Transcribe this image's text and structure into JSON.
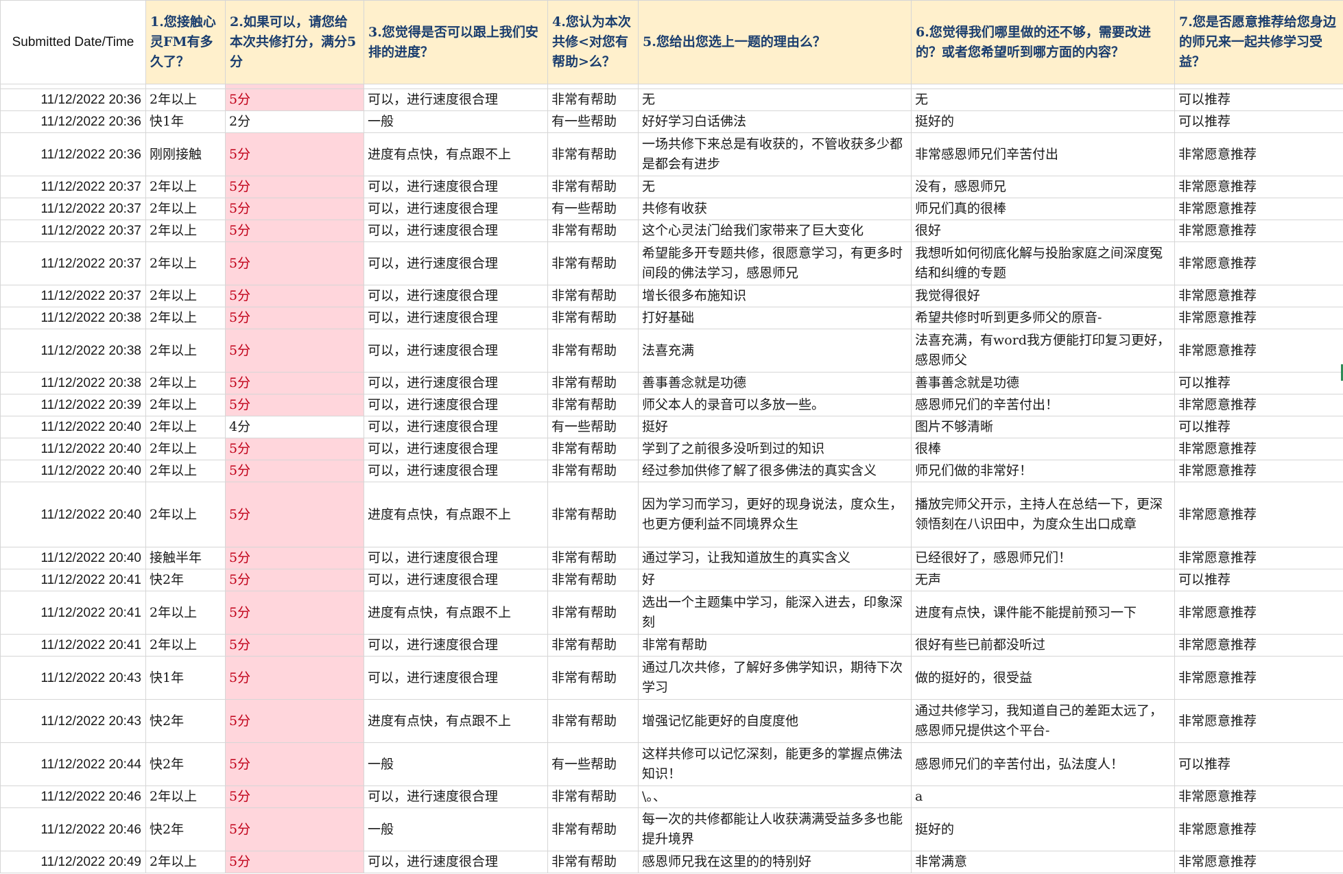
{
  "headers": [
    "Submitted Date/Time",
    "1.您接触心灵FM有多久了？",
    "2.如果可以，请您给本次共修打分，满分5分",
    "3.您觉得是否可以跟上我们安排的进度？",
    "4.您认为本次共修<对您有帮助>么？",
    "5.您给出您选上一题的理由么？",
    "6.您觉得我们哪里做的还不够，需要改进的？或者您希望听到哪方面的内容？",
    "7.您是否愿意推荐给您身边的师兄来一起共修学习受益？"
  ],
  "colors": {
    "header_bg": "#fff0cc",
    "header_text": "#1a3d6e",
    "score_bg": "#ffd6dc",
    "score_text": "#c00018"
  },
  "rows": [
    {
      "date": "11/12/2022 20:36",
      "duration": "2年以上",
      "score": "5分",
      "pace": "可以，进行速度很合理",
      "helpful": "非常有帮助",
      "reason": "无",
      "improve": "无",
      "recommend": "可以推荐"
    },
    {
      "date": "11/12/2022 20:36",
      "duration": "快1年",
      "score": "2分",
      "pace": "一般",
      "helpful": "有一些帮助",
      "reason": "好好学习白话佛法",
      "improve": "挺好的",
      "recommend": "可以推荐"
    },
    {
      "date": "11/12/2022 20:36",
      "duration": "刚刚接触",
      "score": "5分",
      "pace": "进度有点快，有点跟不上",
      "helpful": "非常有帮助",
      "reason": "一场共修下来总是有收获的，不管收获多少都是都会有进步",
      "improve": "非常感恩师兄们辛苦付出",
      "recommend": "非常愿意推荐"
    },
    {
      "date": "11/12/2022 20:37",
      "duration": "2年以上",
      "score": "5分",
      "pace": "可以，进行速度很合理",
      "helpful": "非常有帮助",
      "reason": "无",
      "improve": "没有，感恩师兄",
      "recommend": "非常愿意推荐"
    },
    {
      "date": "11/12/2022 20:37",
      "duration": "2年以上",
      "score": "5分",
      "pace": "可以，进行速度很合理",
      "helpful": "有一些帮助",
      "reason": "共修有收获",
      "improve": "师兄们真的很棒",
      "recommend": "非常愿意推荐"
    },
    {
      "date": "11/12/2022 20:37",
      "duration": "2年以上",
      "score": "5分",
      "pace": "可以，进行速度很合理",
      "helpful": "非常有帮助",
      "reason": "这个心灵法门给我们家带来了巨大变化",
      "improve": "很好",
      "recommend": "非常愿意推荐"
    },
    {
      "date": "11/12/2022 20:37",
      "duration": "2年以上",
      "score": "5分",
      "pace": "可以，进行速度很合理",
      "helpful": "非常有帮助",
      "reason": "希望能多开专题共修，很愿意学习，有更多时间段的佛法学习，感恩师兄",
      "improve": "我想听如何彻底化解与投胎家庭之间深度冤结和纠缠的专题",
      "recommend": "非常愿意推荐"
    },
    {
      "date": "11/12/2022 20:37",
      "duration": "2年以上",
      "score": "5分",
      "pace": "可以，进行速度很合理",
      "helpful": "非常有帮助",
      "reason": "增长很多布施知识",
      "improve": "我觉得很好",
      "recommend": "非常愿意推荐"
    },
    {
      "date": "11/12/2022 20:38",
      "duration": "2年以上",
      "score": "5分",
      "pace": "可以，进行速度很合理",
      "helpful": "非常有帮助",
      "reason": "打好基础",
      "improve": "希望共修时听到更多师父的原音-",
      "recommend": "非常愿意推荐"
    },
    {
      "date": "11/12/2022 20:38",
      "duration": "2年以上",
      "score": "5分",
      "pace": "可以，进行速度很合理",
      "helpful": "非常有帮助",
      "reason": "法喜充满",
      "improve": "法喜充满，有word我方便能打印复习更好，感恩师父",
      "recommend": "非常愿意推荐"
    },
    {
      "date": "11/12/2022 20:38",
      "duration": "2年以上",
      "score": "5分",
      "pace": "可以，进行速度很合理",
      "helpful": "非常有帮助",
      "reason": "善事善念就是功德",
      "improve": "善事善念就是功德",
      "recommend": "可以推荐"
    },
    {
      "date": "11/12/2022 20:39",
      "duration": "2年以上",
      "score": "5分",
      "pace": "可以，进行速度很合理",
      "helpful": "非常有帮助",
      "reason": "师父本人的录音可以多放一些。",
      "improve": "感恩师兄们的辛苦付出！",
      "recommend": "非常愿意推荐"
    },
    {
      "date": "11/12/2022 20:40",
      "duration": "2年以上",
      "score": "4分",
      "pace": "可以，进行速度很合理",
      "helpful": "有一些帮助",
      "reason": "挺好",
      "improve": "图片不够清晰",
      "recommend": "可以推荐"
    },
    {
      "date": "11/12/2022 20:40",
      "duration": "2年以上",
      "score": "5分",
      "pace": "可以，进行速度很合理",
      "helpful": "非常有帮助",
      "reason": "学到了之前很多没听到过的知识",
      "improve": "很棒",
      "recommend": "非常愿意推荐"
    },
    {
      "date": "11/12/2022 20:40",
      "duration": "2年以上",
      "score": "5分",
      "pace": "可以，进行速度很合理",
      "helpful": "非常有帮助",
      "reason": "经过参加供修了解了很多佛法的真实含义",
      "improve": "师兄们做的非常好！",
      "recommend": "非常愿意推荐"
    },
    {
      "date": "11/12/2022 20:40",
      "duration": "2年以上",
      "score": "5分",
      "pace": "进度有点快，有点跟不上",
      "helpful": "非常有帮助",
      "reason": "因为学习而学习，更好的现身说法，度众生，也更方便利益不同境界众生",
      "improve": "播放完师父开示，主持人在总结一下，更深领悟刻在八识田中，为度众生出口成章",
      "recommend": "非常愿意推荐"
    },
    {
      "date": "11/12/2022 20:40",
      "duration": "接触半年",
      "score": "5分",
      "pace": "可以，进行速度很合理",
      "helpful": "非常有帮助",
      "reason": "通过学习，让我知道放生的真实含义",
      "improve": "已经很好了，感恩师兄们！",
      "recommend": "非常愿意推荐"
    },
    {
      "date": "11/12/2022 20:41",
      "duration": "快2年",
      "score": "5分",
      "pace": "可以，进行速度很合理",
      "helpful": "非常有帮助",
      "reason": "好",
      "improve": "无声",
      "recommend": "可以推荐"
    },
    {
      "date": "11/12/2022 20:41",
      "duration": "2年以上",
      "score": "5分",
      "pace": "进度有点快，有点跟不上",
      "helpful": "非常有帮助",
      "reason": "选出一个主题集中学习，能深入进去，印象深刻",
      "improve": "进度有点快，课件能不能提前预习一下",
      "recommend": "非常愿意推荐"
    },
    {
      "date": "11/12/2022 20:41",
      "duration": "2年以上",
      "score": "5分",
      "pace": "可以，进行速度很合理",
      "helpful": "非常有帮助",
      "reason": "非常有帮助",
      "improve": "很好有些已前都没听过",
      "recommend": "非常愿意推荐"
    },
    {
      "date": "11/12/2022 20:43",
      "duration": "快1年",
      "score": "5分",
      "pace": "可以，进行速度很合理",
      "helpful": "非常有帮助",
      "reason": "通过几次共修，了解好多佛学知识，期待下次学习",
      "improve": "做的挺好的，很受益",
      "recommend": "非常愿意推荐"
    },
    {
      "date": "11/12/2022 20:43",
      "duration": "快2年",
      "score": "5分",
      "pace": "进度有点快，有点跟不上",
      "helpful": "非常有帮助",
      "reason": "增强记忆能更好的自度度他",
      "improve": "通过共修学习，我知道自己的差距太远了，感恩师兄提供这个平台-",
      "recommend": "非常愿意推荐"
    },
    {
      "date": "11/12/2022 20:44",
      "duration": "快2年",
      "score": "5分",
      "pace": "一般",
      "helpful": "有一些帮助",
      "reason": "这样共修可以记忆深刻，能更多的掌握点佛法知识！",
      "improve": "感恩师兄们的辛苦付出，弘法度人！",
      "recommend": "可以推荐"
    },
    {
      "date": "11/12/2022 20:46",
      "duration": "2年以上",
      "score": "5分",
      "pace": "可以，进行速度很合理",
      "helpful": "非常有帮助",
      "reason": "\\。、",
      "improve": "a",
      "recommend": "非常愿意推荐"
    },
    {
      "date": "11/12/2022 20:46",
      "duration": "快2年",
      "score": "5分",
      "pace": "一般",
      "helpful": "非常有帮助",
      "reason": "每一次的共修都能让人收获满满受益多多也能提升境界",
      "improve": "挺好的",
      "recommend": "非常愿意推荐"
    },
    {
      "date": "11/12/2022 20:49",
      "duration": "2年以上",
      "score": "5分",
      "pace": "可以，进行速度很合理",
      "helpful": "非常有帮助",
      "reason": "感恩师兄我在这里的的特别好",
      "improve": "非常满意",
      "recommend": "非常愿意推荐"
    }
  ]
}
